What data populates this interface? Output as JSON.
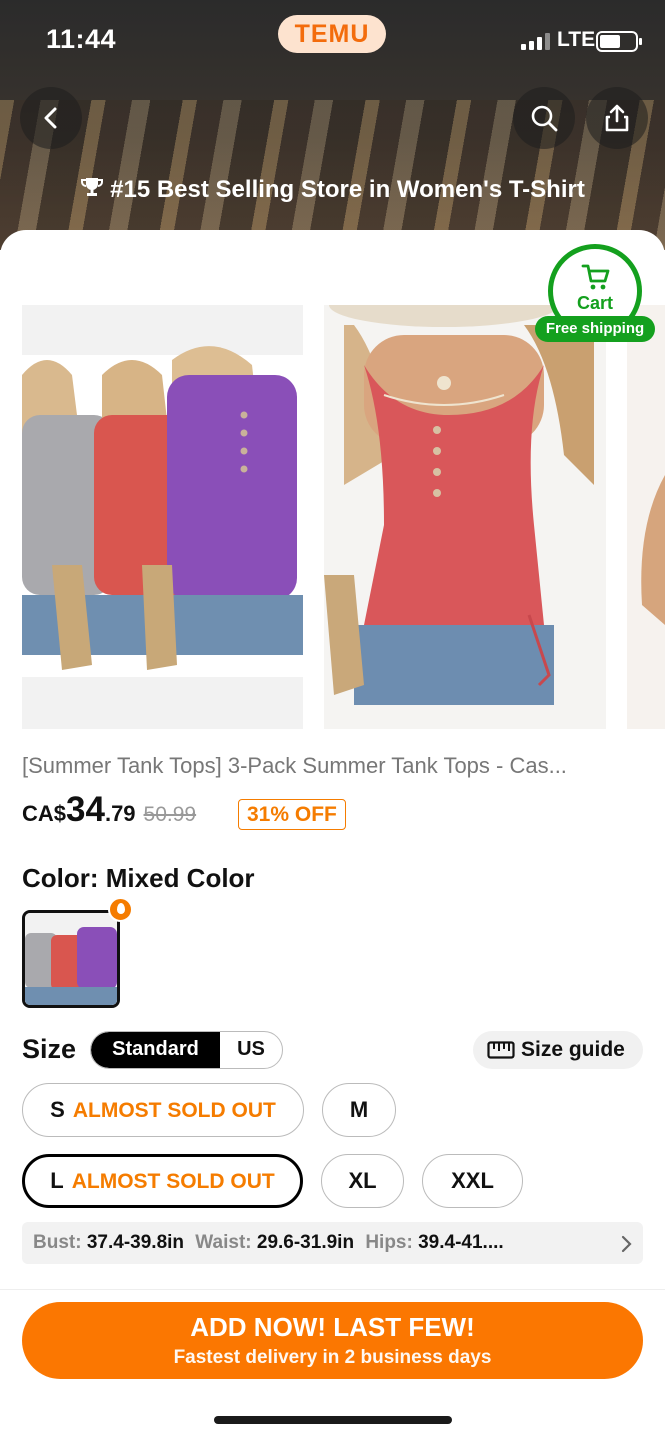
{
  "status_bar": {
    "time": "11:44",
    "app_pill": "TEMU",
    "network": "LTE"
  },
  "header": {
    "icons": [
      "back-icon",
      "search-icon",
      "share-icon"
    ],
    "banner": "#15 Best Selling Store in Women's T-Shirt"
  },
  "cart": {
    "label": "Cart",
    "badge": "Free shipping",
    "color": "#14a01e"
  },
  "product": {
    "title": "[Summer Tank Tops] 3-Pack Summer Tank Tops - Cas...",
    "currency": "CA$",
    "price_whole": "34",
    "price_cents": ".79",
    "old_price": "50.99",
    "discount": "31% OFF",
    "accent": "#f57c00"
  },
  "color": {
    "label": "Color: Mixed Color"
  },
  "size": {
    "label": "Size",
    "tabs": [
      "Standard",
      "US"
    ],
    "guide": "Size guide",
    "options": [
      {
        "size": "S",
        "note": "ALMOST SOLD OUT"
      },
      {
        "size": "M",
        "note": ""
      },
      {
        "size": "L",
        "note": "ALMOST SOLD OUT",
        "selected": true
      },
      {
        "size": "XL",
        "note": ""
      },
      {
        "size": "XXL",
        "note": ""
      }
    ],
    "measurements": {
      "bust_k": "Bust:",
      "bust_v": "37.4-39.8in",
      "waist_k": "Waist:",
      "waist_v": "29.6-31.9in",
      "hips_k": "Hips:",
      "hips_v": "39.4-41...."
    }
  },
  "cta": {
    "line1": "ADD NOW! LAST FEW!",
    "line2": "Fastest delivery in 2 business days",
    "color": "#fb7701"
  }
}
